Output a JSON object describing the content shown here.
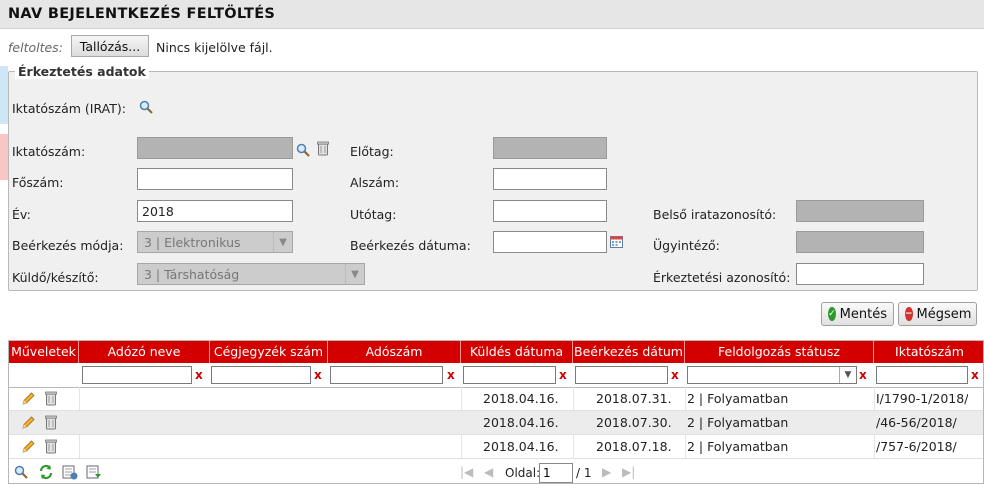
{
  "page": {
    "title": "NAV BEJELENTKEZÉS FELTÖLTÉS"
  },
  "upload": {
    "label": "feltoltes:",
    "browse_label": "Tallózás...",
    "status": "Nincs kijelölve fájl."
  },
  "form": {
    "legend": "Érkeztetés adatok",
    "irat_label": "Iktatószám (IRAT):",
    "iktatoszam_label": "Iktatószám:",
    "elotag_label": "Előtag:",
    "foszam_label": "Főszám:",
    "alszam_label": "Alszám:",
    "ev_label": "Év:",
    "ev_value": "2018",
    "utotag_label": "Utótag:",
    "belso_label": "Belső iratazonosító:",
    "mod_label": "Beérkezés módja:",
    "mod_value": "3 | Elektronikus",
    "datum_label": "Beérkezés dátuma:",
    "ugyintezo_label": "Ügyintéző:",
    "kuldo_label": "Küldő/készítő:",
    "kuldo_value": "3 | Társhatóság",
    "erk_azon_label": "Érkeztetési azonosító:"
  },
  "actions": {
    "save_label": "Mentés",
    "cancel_label": "Mégsem"
  },
  "grid": {
    "columns": [
      "Műveletek",
      "Adózó neve",
      "Cégjegyzék szám",
      "Adószám",
      "Küldés dátuma",
      "Beérkezés dátum",
      "Feldolgozás státusz",
      "Iktatószám"
    ],
    "rows": [
      {
        "kuldes": "2018.04.16.",
        "beerkezes": "2018.07.31.",
        "statusz": "2 | Folyamatban",
        "iktatoszam": "I/1790-1/2018/"
      },
      {
        "kuldes": "2018.04.16.",
        "beerkezes": "2018.07.30.",
        "statusz": "2 | Folyamatban",
        "iktatoszam": "/46-56/2018/"
      },
      {
        "kuldes": "2018.04.16.",
        "beerkezes": "2018.07.18.",
        "statusz": "2 | Folyamatban",
        "iktatoszam": "/757-6/2018/"
      }
    ],
    "filter_clear": "x"
  },
  "pager": {
    "label": "Oldal:",
    "page_value": "1",
    "total": "/ 1"
  },
  "icons": {
    "search": "magnifier-icon",
    "delete": "trash-icon",
    "calendar": "calendar-icon",
    "edit": "pencil-icon",
    "refresh": "refresh-icon",
    "export": "export-icon",
    "import": "import-icon"
  },
  "colors": {
    "header_red": "#d40000",
    "accent_green": "#2e9a2e",
    "cancel_red": "#d33030"
  }
}
